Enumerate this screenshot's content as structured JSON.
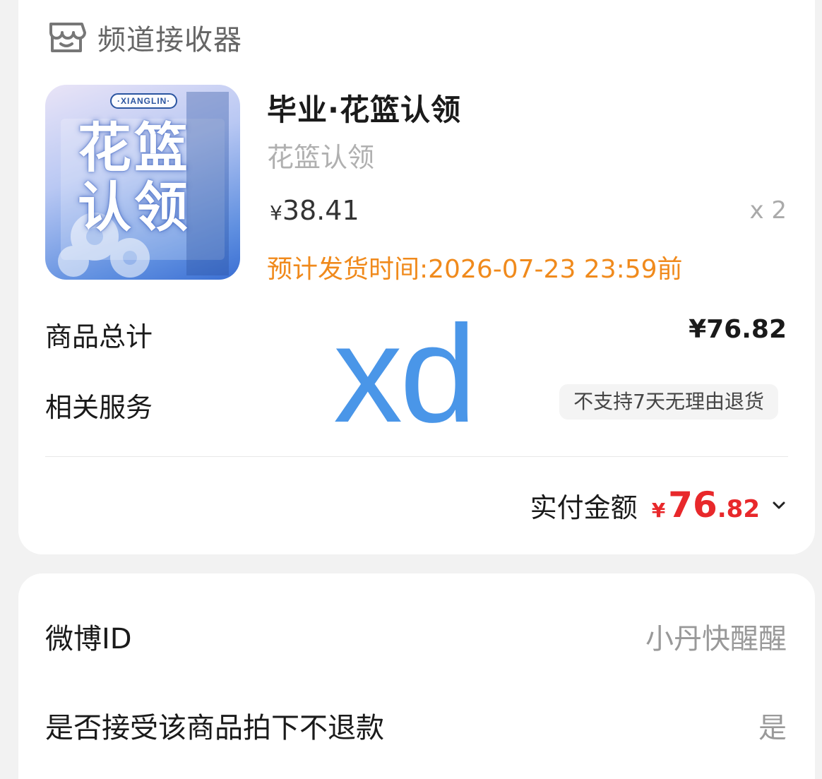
{
  "shop": {
    "icon": "store-icon",
    "name": "频道接收器"
  },
  "product": {
    "image": {
      "badge": "·XIANGLIN·",
      "title_line1": "花篮",
      "title_line2": "认领"
    },
    "title": "毕业·花篮认领",
    "spec": "花篮认领",
    "price_symbol": "¥",
    "price": "38.41",
    "quantity": "x 2",
    "ship_time": "预计发货时间:2026-07-23 23:59前",
    "ship_time_color": "#f08a1c"
  },
  "summary": {
    "subtotal_label": "商品总计",
    "subtotal_value": "¥76.82",
    "service_label": "相关服务",
    "service_tag": "不支持7天无理由退货",
    "watermark": "xd",
    "total_label": "实付金额",
    "total_symbol": "¥",
    "total_int": "76",
    "total_dec": ".82",
    "total_color": "#e8282b",
    "expand_icon": "chevron-down-icon"
  },
  "info": {
    "weibo_label": "微博ID",
    "weibo_value": "小丹快醒醒",
    "refund_label": "是否接受该商品拍下不退款",
    "refund_value": "是"
  }
}
